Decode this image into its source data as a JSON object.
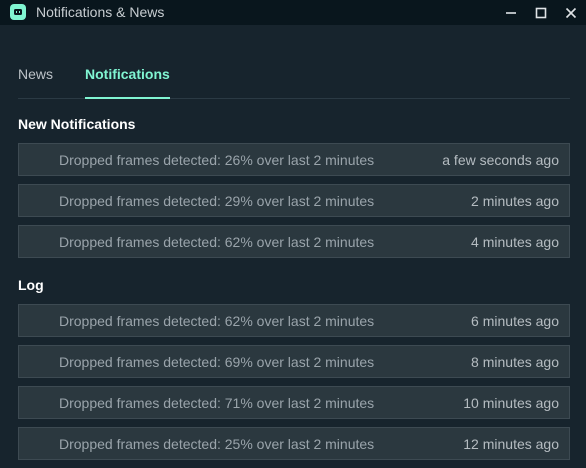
{
  "window": {
    "title": "Notifications & News",
    "icon": "streamlabs-app-icon",
    "controls": [
      "minimize-icon",
      "maximize-icon",
      "close-icon"
    ]
  },
  "tabs": [
    {
      "label": "News",
      "active": false
    },
    {
      "label": "Notifications",
      "active": true
    }
  ],
  "sections": {
    "new": {
      "heading": "New Notifications",
      "items": [
        {
          "message": "Dropped frames detected: 26% over last 2 minutes",
          "time": "a few seconds ago"
        },
        {
          "message": "Dropped frames detected: 29% over last 2 minutes",
          "time": "2 minutes ago"
        },
        {
          "message": "Dropped frames detected: 62% over last 2 minutes",
          "time": "4 minutes ago"
        }
      ]
    },
    "log": {
      "heading": "Log",
      "items": [
        {
          "message": "Dropped frames detected: 62% over last 2 minutes",
          "time": "6 minutes ago"
        },
        {
          "message": "Dropped frames detected: 69% over last 2 minutes",
          "time": "8 minutes ago"
        },
        {
          "message": "Dropped frames detected: 71% over last 2 minutes",
          "time": "10 minutes ago"
        },
        {
          "message": "Dropped frames detected: 25% over last 2 minutes",
          "time": "12 minutes ago"
        }
      ]
    }
  },
  "colors": {
    "background": "#17242d",
    "titlebar": "#09161d",
    "accent": "#80f5d2",
    "row_bg": "#2b383f",
    "row_border": "#3d4a52"
  }
}
